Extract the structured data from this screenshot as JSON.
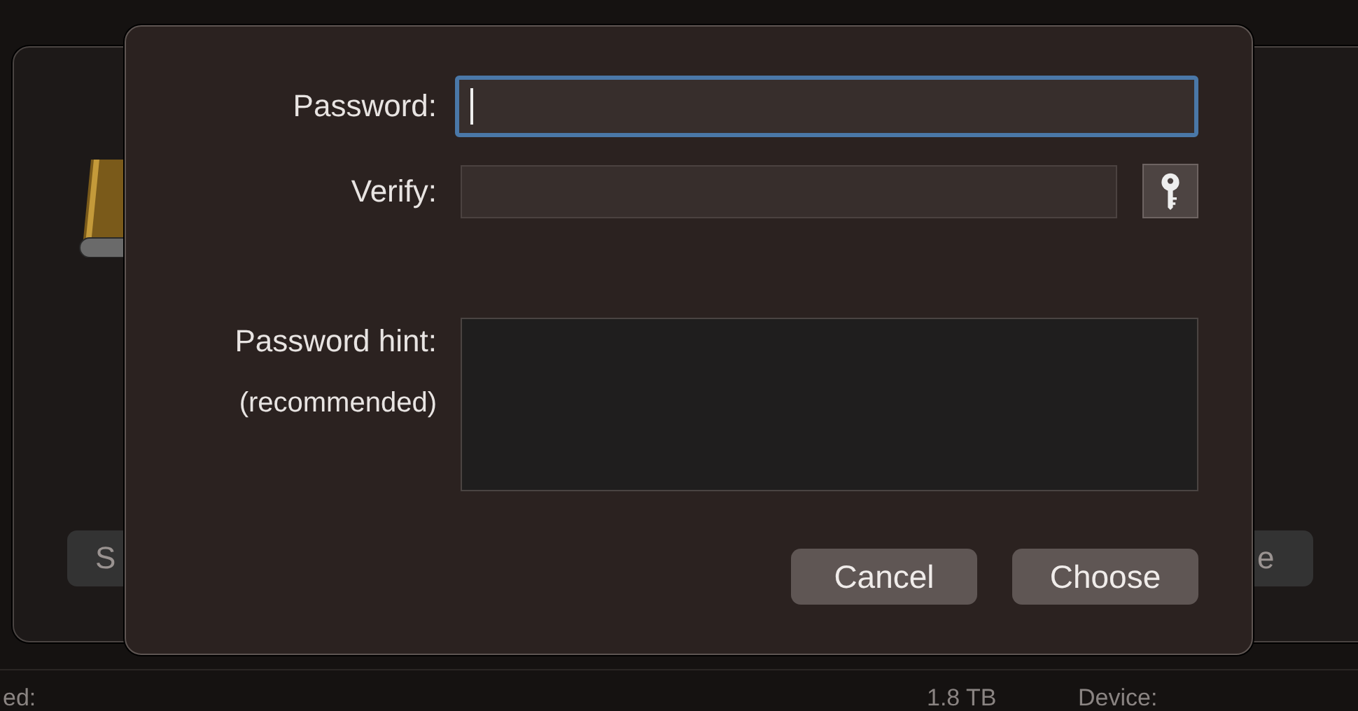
{
  "background": {
    "left_button": "S",
    "right_button": "e",
    "footer": [
      {
        "text": "ed:"
      },
      {
        "text": "1.8 TB"
      },
      {
        "text": "Device:"
      }
    ]
  },
  "dialog": {
    "fields": [
      {
        "label": "Password:",
        "focused": true,
        "key_button": false
      },
      {
        "label": "Verify:",
        "focused": false,
        "key_button": true
      }
    ],
    "hint": {
      "label": "Password hint:",
      "note": "(recommended)"
    },
    "buttons": [
      {
        "label": "Cancel"
      },
      {
        "label": "Choose"
      }
    ]
  }
}
